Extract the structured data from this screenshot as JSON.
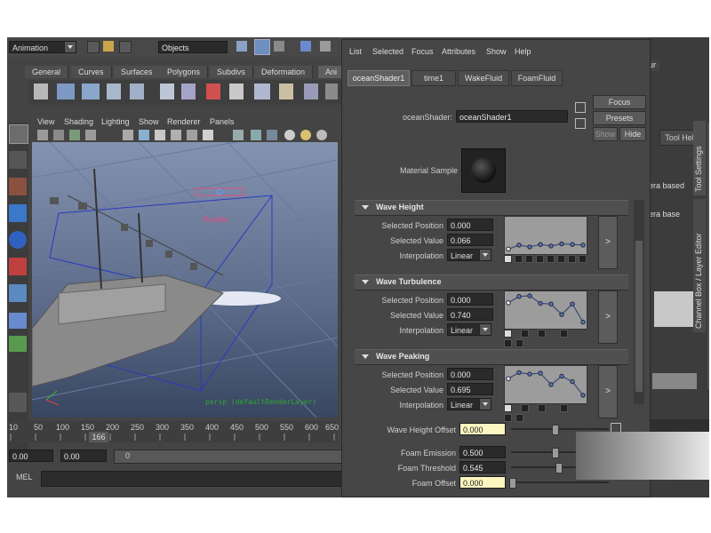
{
  "top_bar": {
    "mode_select": "Animation",
    "objects_field": "Objects"
  },
  "shelf_tabs": [
    "General",
    "Curves",
    "Surfaces",
    "Polygons",
    "Subdivs",
    "Deformation",
    "Ani"
  ],
  "viewport": {
    "menu": [
      "View",
      "Shading",
      "Lighting",
      "Show",
      "Renderer",
      "Panels"
    ],
    "rudder_label": "Rudder",
    "layer_text": "persp (defaultRenderLayer)"
  },
  "timeline": {
    "ticks": [
      "10",
      "50",
      "100",
      "150",
      "200",
      "250",
      "300",
      "350",
      "400",
      "450",
      "500",
      "550",
      "600",
      "650"
    ],
    "current_frame": "166",
    "start_field": "0.00",
    "end_field": "0.00",
    "range_field": "0"
  },
  "command_line": {
    "label": "MEL"
  },
  "attr_editor": {
    "menu": [
      "List",
      "Selected",
      "Focus",
      "Attributes",
      "Show",
      "Help"
    ],
    "tabs": [
      "oceanShader1",
      "time1",
      "WakeFluid",
      "FoamFluid"
    ],
    "shader_label": "oceanShader:",
    "shader_value": "oceanShader1",
    "buttons": {
      "focus": "Focus",
      "presets": "Presets",
      "show": "Show",
      "hide": "Hide"
    },
    "material_sample_label": "Material Sample",
    "wave_height": {
      "title": "Wave Height",
      "selected_position_label": "Selected Position",
      "selected_position": "0.000",
      "selected_value_label": "Selected Value",
      "selected_value": "0.066",
      "interpolation_label": "Interpolation",
      "interpolation": "Linear",
      "curve": [
        0.05,
        0.18,
        0.12,
        0.2,
        0.15,
        0.22,
        0.2,
        0.18
      ]
    },
    "wave_turbulence": {
      "title": "Wave Turbulence",
      "selected_position_label": "Selected Position",
      "selected_position": "0.000",
      "selected_value_label": "Selected Value",
      "selected_value": "0.740",
      "interpolation_label": "Interpolation",
      "interpolation": "Linear",
      "curve": [
        0.74,
        0.95,
        0.97,
        0.72,
        0.7,
        0.35,
        0.7,
        0.1
      ]
    },
    "wave_peaking": {
      "title": "Wave Peaking",
      "selected_position_label": "Selected Position",
      "selected_position": "0.000",
      "selected_value_label": "Selected Value",
      "selected_value": "0.695",
      "interpolation_label": "Interpolation",
      "interpolation": "Linear",
      "curve": [
        0.7,
        0.9,
        0.85,
        0.88,
        0.5,
        0.78,
        0.6,
        0.15
      ]
    },
    "arrow_button": ">",
    "wave_height_offset_label": "Wave Height Offset",
    "wave_height_offset": "0.000",
    "foam_emission_label": "Foam Emission",
    "foam_emission": "0.500",
    "foam_threshold_label": "Foam Threshold",
    "foam_threshold": "0.545",
    "foam_offset_label": "Foam Offset",
    "foam_offset": "0.000"
  },
  "right_panel": {
    "tool_help": "Tool Help",
    "vertical_tab_1": "Tool Settings",
    "vertical_tab_2": "Channel Box / Layer Editor",
    "partial_text_1": "era based",
    "partial_text_2": "era base",
    "partial_top": "ur"
  },
  "colors": {
    "ui_bg": "#444444",
    "highlight_field": "#fdf6c0",
    "viewport_sky": "#7b8aa8",
    "tab_active": "#5f5f5f"
  }
}
